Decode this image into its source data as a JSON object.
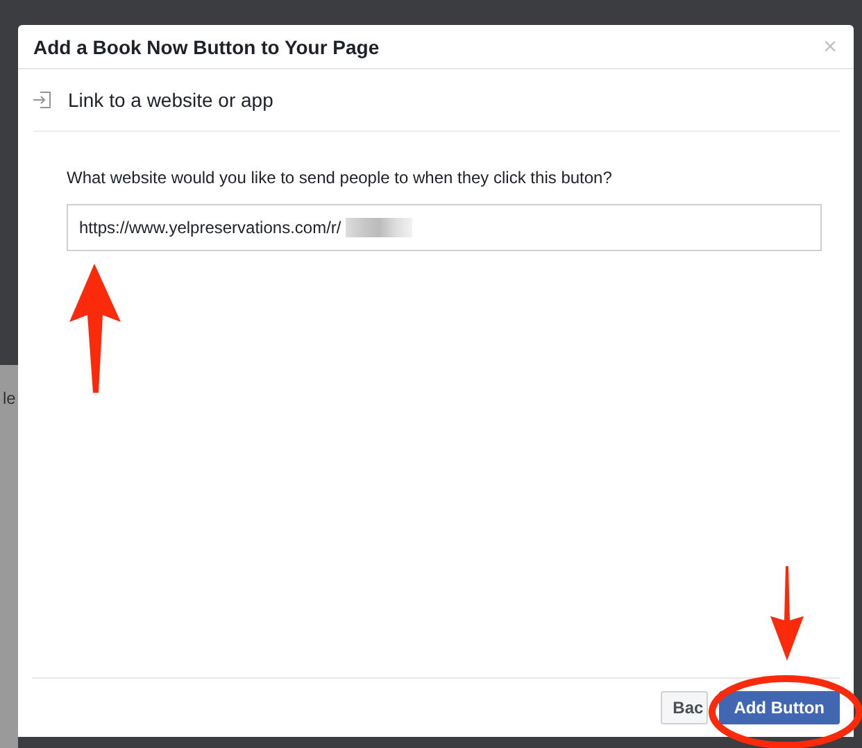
{
  "background": {
    "fragment": "le"
  },
  "dialog": {
    "title": "Add a Book Now Button to Your Page",
    "close": "×",
    "section": {
      "label": "Link to a website or app"
    },
    "question": "What website would you like to send people to when they click this buton?",
    "url_field": {
      "value": "https://www.yelpreservations.com/r/"
    },
    "buttons": [
      {
        "label": "Bac",
        "kind": "secondary"
      },
      {
        "label": "Add Button",
        "kind": "primary"
      }
    ]
  }
}
